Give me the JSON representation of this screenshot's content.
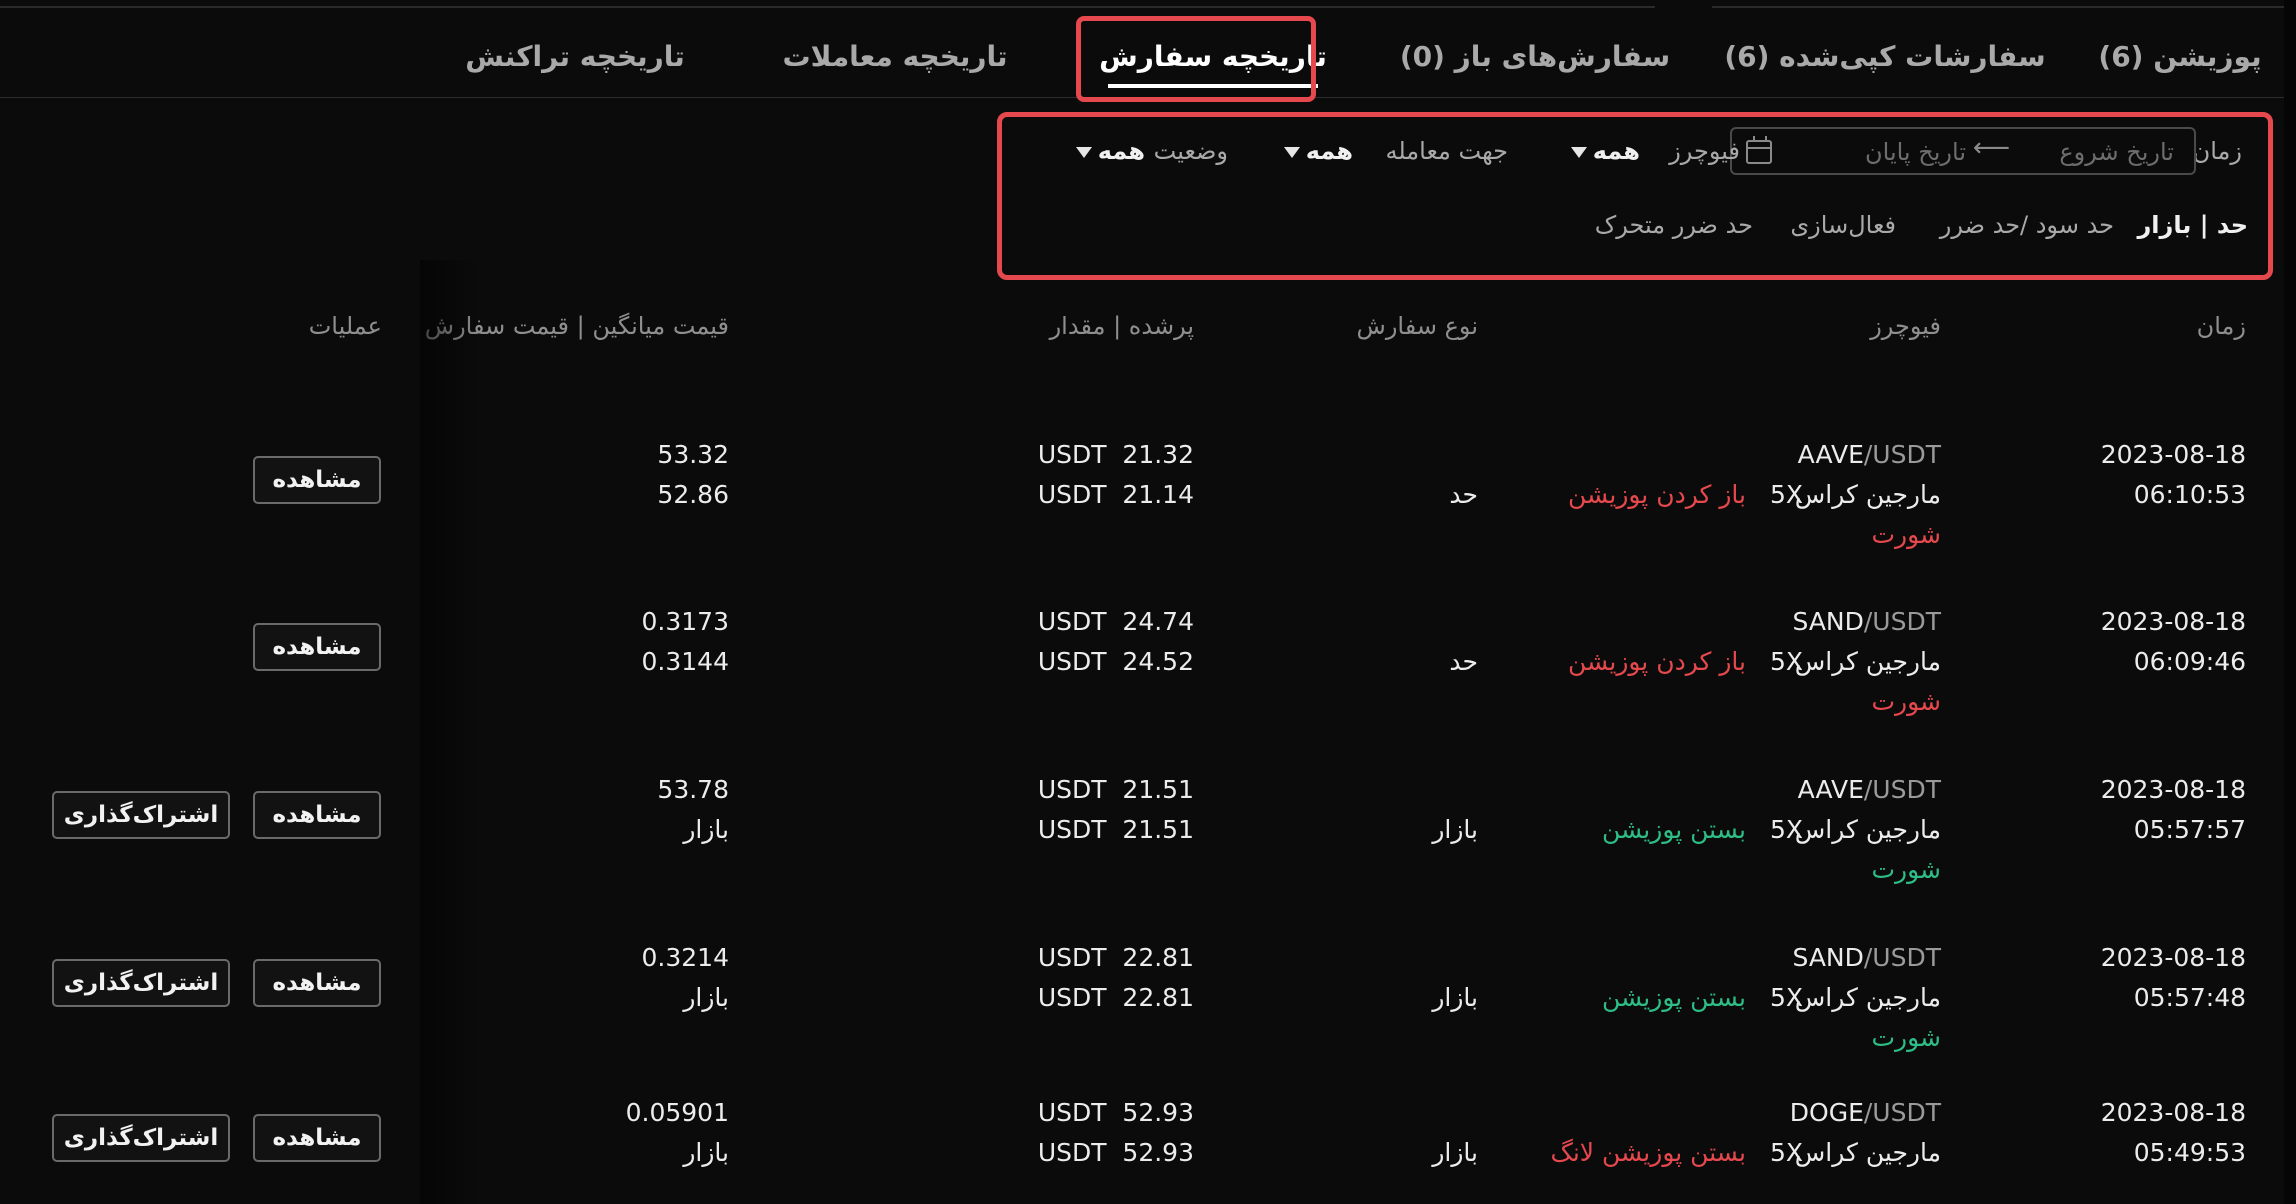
{
  "tabs": [
    {
      "label": "پوزیشن (6)"
    },
    {
      "label": "سفارشات کپی‌شده (6)"
    },
    {
      "label": "سفارش‌های باز (0)"
    },
    {
      "label": "تاریخچه سفارش"
    },
    {
      "label": "تاریخچه معاملات"
    },
    {
      "label": "تاریخچه تراکنش"
    }
  ],
  "active_tab": "تاریخچه سفارش",
  "filters": {
    "time_label": "زمان",
    "start_date_placeholder": "تاریخ شروع",
    "end_date_placeholder": "تاریخ پایان",
    "futures_label": "فیوچرز",
    "futures_value": "همه",
    "direction_label": "جهت معامله",
    "direction_value": "همه",
    "status_label": "وضعیت",
    "status_value": "همه"
  },
  "order_types": [
    {
      "label": "حد | بازار",
      "active": true
    },
    {
      "label": "حد سود /حد ضرر",
      "active": false
    },
    {
      "label": "فعال‌سازی",
      "active": false
    },
    {
      "label": "حد ضرر متحرک",
      "active": false
    }
  ],
  "columns": {
    "time": "زمان",
    "futures": "فیوچرز",
    "order_type": "نوع سفارش",
    "filled_amount": "پرشده | مقدار",
    "price": "قیمت میانگین | قیمت سفارش",
    "actions": "عملیات"
  },
  "rows": [
    {
      "date": "2023-08-18",
      "time": "06:10:53",
      "base": "AAVE",
      "quote": "/USDT",
      "margin": "مارجین کراس",
      "leverage": "5X",
      "action": "باز کردن پوزیشن",
      "action_color": "red",
      "side": "شورت",
      "side_color": "red",
      "order_type": "حد",
      "filled": "21.32",
      "amount": "21.14",
      "unit": "USDT",
      "avg_price": "53.32",
      "order_price": "52.86",
      "view": "مشاهده",
      "share": ""
    },
    {
      "date": "2023-08-18",
      "time": "06:09:46",
      "base": "SAND",
      "quote": "/USDT",
      "margin": "مارجین کراس",
      "leverage": "5X",
      "action": "باز کردن پوزیشن",
      "action_color": "red",
      "side": "شورت",
      "side_color": "red",
      "order_type": "حد",
      "filled": "24.74",
      "amount": "24.52",
      "unit": "USDT",
      "avg_price": "0.3173",
      "order_price": "0.3144",
      "view": "مشاهده",
      "share": ""
    },
    {
      "date": "2023-08-18",
      "time": "05:57:57",
      "base": "AAVE",
      "quote": "/USDT",
      "margin": "مارجین کراس",
      "leverage": "5X",
      "action": "بستن پوزیشن",
      "action_color": "green",
      "side": "شورت",
      "side_color": "green",
      "order_type": "بازار",
      "filled": "21.51",
      "amount": "21.51",
      "unit": "USDT",
      "avg_price": "53.78",
      "order_price": "بازار",
      "view": "مشاهده",
      "share": "اشتراک‌گذاری"
    },
    {
      "date": "2023-08-18",
      "time": "05:57:48",
      "base": "SAND",
      "quote": "/USDT",
      "margin": "مارجین کراس",
      "leverage": "5X",
      "action": "بستن پوزیشن",
      "action_color": "green",
      "side": "شورت",
      "side_color": "green",
      "order_type": "بازار",
      "filled": "22.81",
      "amount": "22.81",
      "unit": "USDT",
      "avg_price": "0.3214",
      "order_price": "بازار",
      "view": "مشاهده",
      "share": "اشتراک‌گذاری"
    },
    {
      "date": "2023-08-18",
      "time": "05:49:53",
      "base": "DOGE",
      "quote": "/USDT",
      "margin": "مارجین کراس",
      "leverage": "5X",
      "action": "بستن پوزیشن لانگ",
      "action_color": "red",
      "side": "",
      "side_color": "red",
      "order_type": "بازار",
      "filled": "52.93",
      "amount": "52.93",
      "unit": "USDT",
      "avg_price": "0.05901",
      "order_price": "بازار",
      "view": "مشاهده",
      "share": "اشتراک‌گذاری"
    }
  ],
  "colors": {
    "accent_red": "#e5484d",
    "positive_green": "#2ebd85",
    "background": "#0b0b0b"
  }
}
